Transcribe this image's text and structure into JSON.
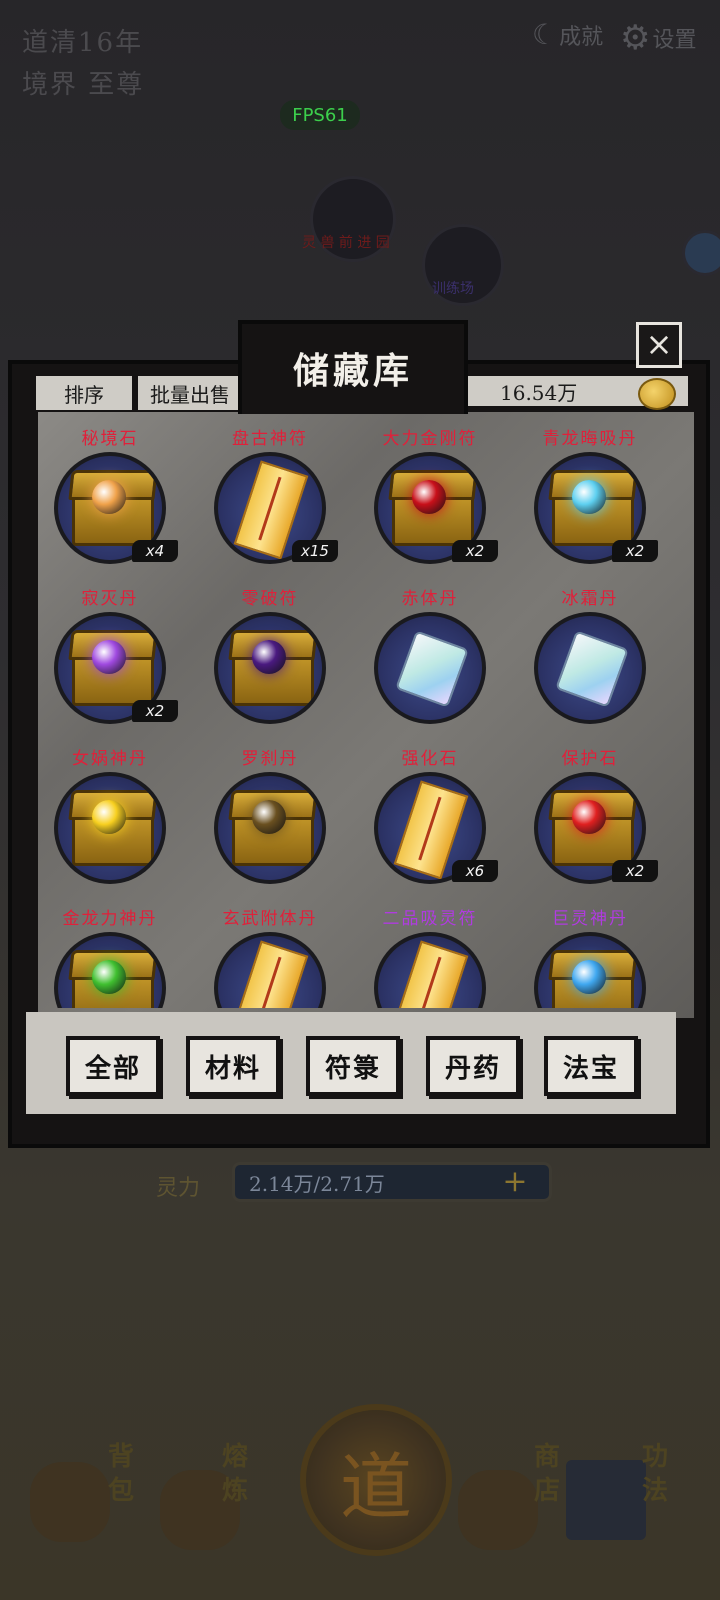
{
  "hud": {
    "line1": "道清16年",
    "line2": "境界 至尊",
    "fps": "FPS61",
    "achievement": "成就",
    "settings": "设置"
  },
  "background_labels": {
    "map_label": "灵 兽 前 进 园",
    "boss_label": "训练场"
  },
  "storage": {
    "title": "储藏库",
    "sort_label": "排序",
    "bulk_sell_label": "批量出售",
    "currency_amount": "16.54万",
    "close_symbol": "×"
  },
  "items": [
    {
      "name": "秘境石",
      "qty": "x4",
      "kind": "chest",
      "orb": "#f0a24a",
      "color": "red"
    },
    {
      "name": "盘古神符",
      "qty": "x15",
      "kind": "scroll",
      "orb": "",
      "color": "red"
    },
    {
      "name": "大力金刚符",
      "qty": "x2",
      "kind": "chest",
      "orb": "#c8101a",
      "color": "red"
    },
    {
      "name": "青龙晦吸丹",
      "qty": "x2",
      "kind": "chest",
      "orb": "#5ed0f0",
      "color": "red"
    },
    {
      "name": "寂灭丹",
      "qty": "x2",
      "kind": "chest",
      "orb": "#a04ae0",
      "color": "red"
    },
    {
      "name": "零破符",
      "qty": "",
      "kind": "chest",
      "orb": "#4a1a80",
      "color": "red"
    },
    {
      "name": "赤体丹",
      "qty": "",
      "kind": "crystal",
      "orb": "",
      "color": "red"
    },
    {
      "name": "冰霜丹",
      "qty": "",
      "kind": "crystal",
      "orb": "",
      "color": "red"
    },
    {
      "name": "女娲神丹",
      "qty": "",
      "kind": "chest",
      "orb": "#f8d020",
      "color": "red"
    },
    {
      "name": "罗刹丹",
      "qty": "",
      "kind": "chest",
      "orb": "#6a5020",
      "color": "red"
    },
    {
      "name": "强化石",
      "qty": "x6",
      "kind": "scroll",
      "orb": "",
      "color": "red"
    },
    {
      "name": "保护石",
      "qty": "x2",
      "kind": "chest",
      "orb": "#e02020",
      "color": "red"
    },
    {
      "name": "金龙力神丹",
      "qty": "",
      "kind": "chest",
      "orb": "#40c030",
      "color": "red"
    },
    {
      "name": "玄武附体丹",
      "qty": "",
      "kind": "scroll",
      "orb": "",
      "color": "red"
    },
    {
      "name": "二品吸灵符",
      "qty": "",
      "kind": "scroll",
      "orb": "",
      "color": "purple"
    },
    {
      "name": "巨灵神丹",
      "qty": "",
      "kind": "chest",
      "orb": "#40a8f0",
      "color": "purple"
    }
  ],
  "categories": [
    "全部",
    "材料",
    "符箓",
    "丹药",
    "法宝"
  ],
  "spirit": {
    "label": "灵力",
    "value": "2.14万/2.71万",
    "plus": "+"
  },
  "bottom_nav": {
    "bag": "背包",
    "refine": "熔炼",
    "shop": "商店",
    "skills": "功法",
    "dao": "道"
  },
  "icons": {
    "achievement": "moon-icon",
    "settings": "gear-icon",
    "close": "close-icon",
    "coin": "coin-icon"
  }
}
